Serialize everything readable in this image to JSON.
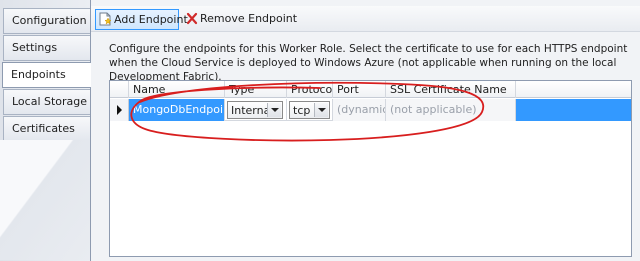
{
  "sidebar": {
    "tabs": [
      {
        "label": "Configuration",
        "active": false
      },
      {
        "label": "Settings",
        "active": false
      },
      {
        "label": "Endpoints",
        "active": true
      },
      {
        "label": "Local Storage",
        "active": false
      },
      {
        "label": "Certificates",
        "active": false
      }
    ]
  },
  "toolbar": {
    "add_label": "Add Endpoint",
    "add_icon": "add-document-icon",
    "remove_label": "Remove Endpoint",
    "remove_icon": "red-x-icon"
  },
  "description": "Configure the endpoints for this Worker Role.  Select the certificate to use for each HTTPS endpoint when the Cloud Service is deployed to Windows Azure (not applicable when running on the local Development Fabric).",
  "grid": {
    "columns": [
      "Name",
      "Type",
      "Protocol",
      "Port",
      "SSL Certificate Name"
    ],
    "rows": [
      {
        "name": "MongoDbEndpoint",
        "type": "Internal",
        "protocol": "tcp",
        "port": "(dynamic)",
        "ssl": "(not applicable)"
      }
    ]
  },
  "colors": {
    "selection": "#3399ff",
    "annotation": "#d81e1e"
  }
}
